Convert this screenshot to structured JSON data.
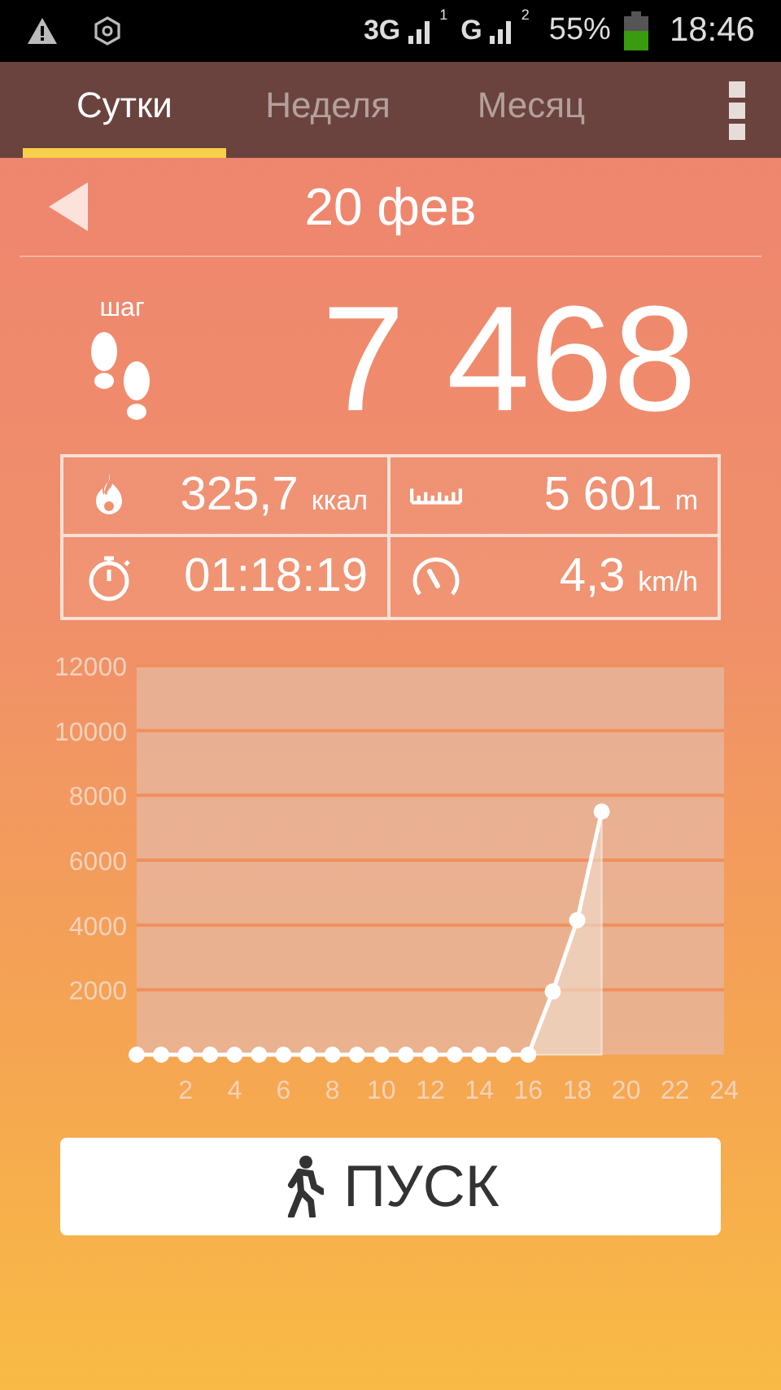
{
  "status_bar": {
    "network_1": "3G",
    "sim_1": "1",
    "network_2": "G",
    "sim_2": "2",
    "battery": "55%",
    "time": "18:46"
  },
  "tabs": [
    {
      "label": "Сутки",
      "selected": true
    },
    {
      "label": "Неделя",
      "selected": false
    },
    {
      "label": "Месяц",
      "selected": false
    }
  ],
  "date": {
    "label": "20 фев"
  },
  "steps": {
    "unit": "шаг",
    "value": "7 468"
  },
  "stats": [
    {
      "kind": "calories",
      "value": "325,7",
      "unit": "ккал"
    },
    {
      "kind": "distance",
      "value": "5 601",
      "unit": "m"
    },
    {
      "kind": "duration",
      "value": "01:18:19"
    },
    {
      "kind": "speed",
      "value": "4,3",
      "unit": "km/h"
    }
  ],
  "chart": {
    "chart_data": {
      "type": "line",
      "x": [
        0,
        1,
        2,
        3,
        4,
        5,
        6,
        7,
        8,
        9,
        10,
        11,
        12,
        13,
        14,
        15,
        16,
        17,
        18,
        19
      ],
      "series": [
        {
          "color": "#ffffff",
          "marker": true,
          "values": [
            0,
            0,
            0,
            0,
            0,
            0,
            0,
            0,
            0,
            0,
            0,
            0,
            0,
            0,
            0,
            0,
            0,
            1950,
            4150,
            7500
          ]
        }
      ],
      "grid": true,
      "xlim": [
        0,
        24
      ],
      "ylim": [
        0,
        12000
      ],
      "xticks": [
        2,
        4,
        6,
        8,
        10,
        12,
        14,
        16,
        18,
        20,
        22,
        24
      ],
      "yticks": [
        2000,
        4000,
        6000,
        8000,
        10000,
        12000
      ]
    }
  },
  "start_button": {
    "label": "ПУСК"
  }
}
